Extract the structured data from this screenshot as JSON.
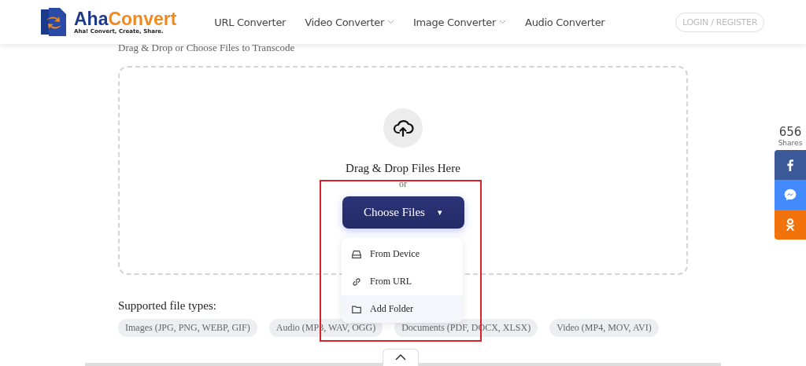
{
  "header": {
    "logo": {
      "name_part1": "Aha",
      "name_part2": "Convert",
      "tagline": "Aha! Convert, Create, Share."
    },
    "nav": [
      {
        "label": "URL Converter",
        "has_menu": false
      },
      {
        "label": "Video Converter",
        "has_menu": true
      },
      {
        "label": "Image Converter",
        "has_menu": true
      },
      {
        "label": "Audio Converter",
        "has_menu": false
      }
    ],
    "login": "LOGIN / REGISTER"
  },
  "upload": {
    "subtitle": "Drag & Drop or Choose Files to Transcode",
    "drop_text": "Drag & Drop Files Here",
    "or": "or",
    "button": "Choose Files",
    "caret": "▾",
    "menu": [
      {
        "kind": "device",
        "label": "From Device",
        "selected": false
      },
      {
        "kind": "url",
        "label": "From URL",
        "selected": false
      },
      {
        "kind": "folder",
        "label": "Add Folder",
        "selected": true
      }
    ]
  },
  "supported": {
    "title": "Supported file types:",
    "types": [
      "Images (JPG, PNG, WEBP, GIF)",
      "Audio (MP3, WAV, OGG)",
      "Documents (PDF, DOCX, XLSX)",
      "Video (MP4, MOV, AVI)"
    ]
  },
  "share": {
    "count": "656",
    "label": "Shares",
    "buttons": [
      {
        "kind": "facebook",
        "color": "#3b5998"
      },
      {
        "kind": "messenger",
        "color": "#448aff"
      },
      {
        "kind": "odnoklassniki",
        "color": "#f2720c"
      }
    ]
  }
}
